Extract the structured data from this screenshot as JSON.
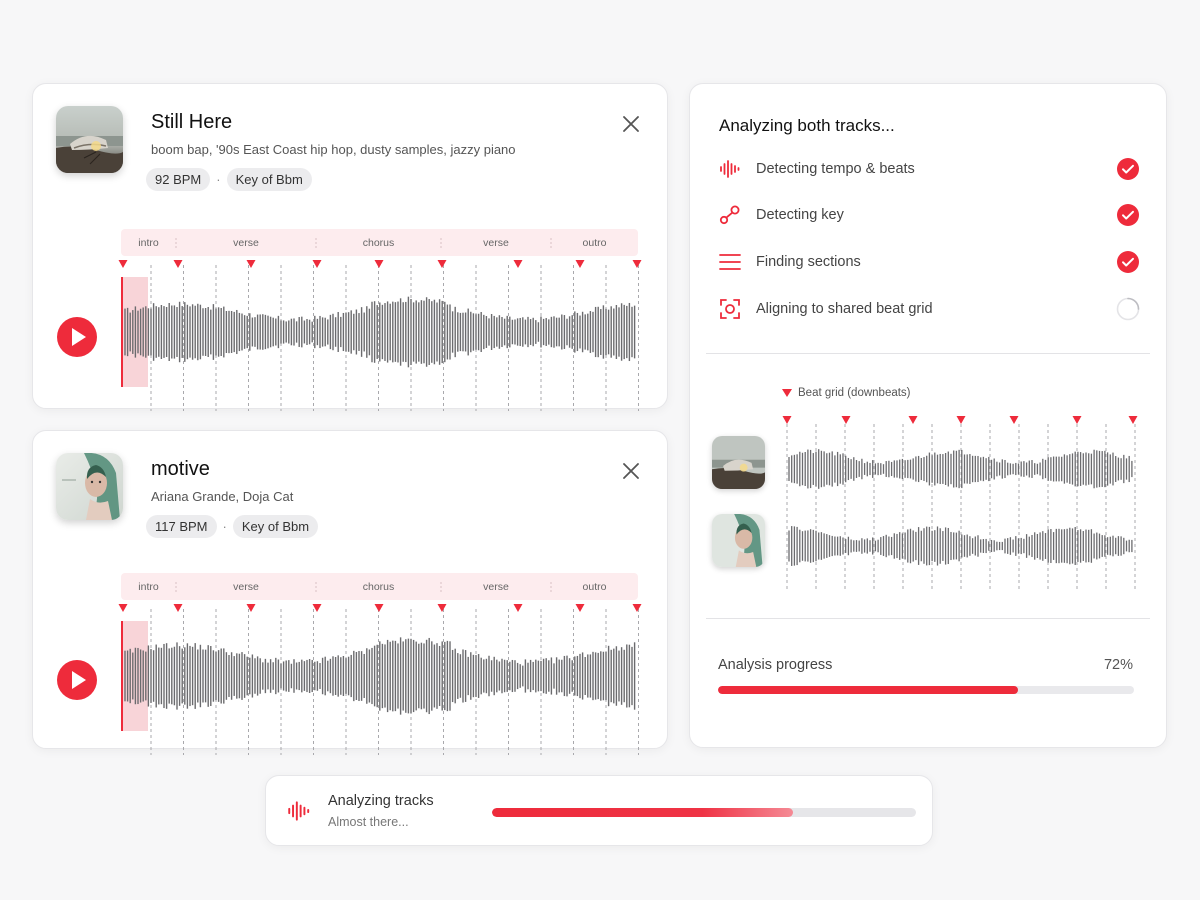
{
  "colors": {
    "accent": "#ee2b3b",
    "wave": "#6b6b6e",
    "section_band": "#fdecee",
    "muted": "#e9e9ec"
  },
  "tracks": [
    {
      "title": "Still Here",
      "subtitle": "boom bap, '90s East Coast hip hop, dusty samples, jazzy piano",
      "bpm": "92 BPM",
      "key": "Key of Bbm",
      "art_icon": "sneaker-on-shore-art",
      "sections": [
        "intro",
        "verse",
        "chorus",
        "verse",
        "outro"
      ]
    },
    {
      "title": "motive",
      "subtitle": "Ariana Grande, Doja Cat",
      "bpm": "117 BPM",
      "key": "Key of Bbm",
      "art_icon": "portrait-art",
      "sections": [
        "intro",
        "verse",
        "chorus",
        "verse",
        "outro"
      ]
    }
  ],
  "analysis": {
    "heading": "Analyzing both tracks...",
    "steps": [
      {
        "label": "Detecting tempo & beats",
        "icon": "waveform-icon",
        "status": "done"
      },
      {
        "label": "Detecting key",
        "icon": "key-node-icon",
        "status": "done"
      },
      {
        "label": "Finding sections",
        "icon": "sections-list-icon",
        "status": "done"
      },
      {
        "label": "Aligning to shared beat grid",
        "icon": "align-target-icon",
        "status": "in-progress"
      }
    ],
    "beat_grid_label": "Beat grid (downbeats)",
    "progress_label": "Analysis progress",
    "progress_pct_text": "72%",
    "progress_value": 0.72
  },
  "toast": {
    "title": "Analyzing tracks",
    "subtitle": "Almost there...",
    "icon": "waveform-icon",
    "progress_value": 0.71
  }
}
